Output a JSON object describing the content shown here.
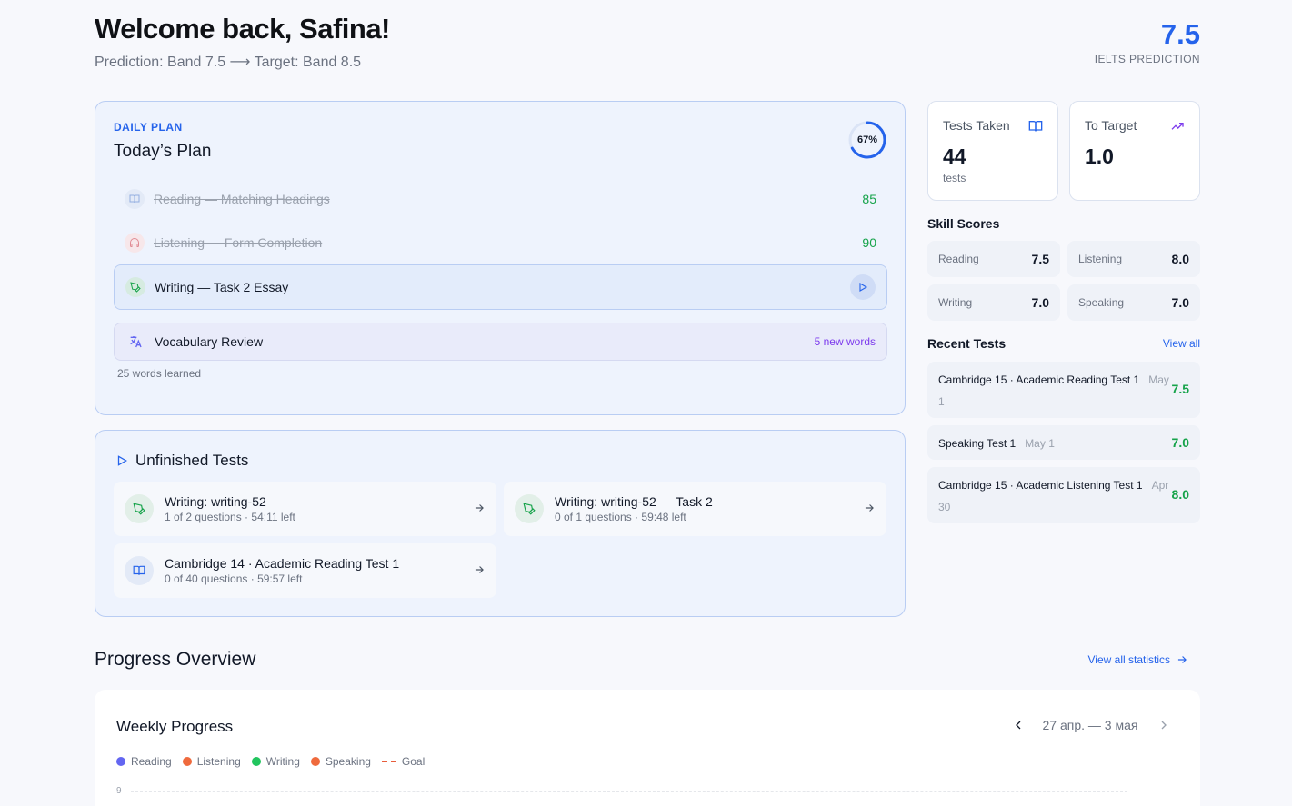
{
  "header": {
    "welcome": "Welcome back, Safina!",
    "prediction_line": "Prediction: Band 7.5 ⟶ Target: Band 8.5",
    "prediction_value": "7.5",
    "prediction_label": "IELTS PREDICTION"
  },
  "daily_plan": {
    "eyebrow": "DAILY PLAN",
    "title": "Today’s Plan",
    "progress_percent": 67,
    "progress_label": "67%",
    "items": [
      {
        "label": "Reading — Matching Headings",
        "score": "85",
        "done": true,
        "icon": "book-icon"
      },
      {
        "label": "Listening — Form Completion",
        "score": "90",
        "done": true,
        "icon": "headphones-icon"
      },
      {
        "label": "Writing — Task 2 Essay",
        "done": false,
        "icon": "pen-icon"
      }
    ],
    "vocab": {
      "label": "Vocabulary Review",
      "badge": "5 new words",
      "icon": "translate-icon"
    },
    "words_learned": "25 words learned"
  },
  "unfinished": {
    "title": "Unfinished Tests",
    "tests": [
      {
        "name": "Writing: writing-52",
        "meta": "1 of 2 questions · 54:11 left",
        "icon": "pen-icon"
      },
      {
        "name": "Writing: writing-52 — Task 2",
        "meta": "0 of 1 questions · 59:48 left",
        "icon": "pen-icon"
      },
      {
        "name": "Cambridge 14 · Academic Reading Test 1",
        "meta": "0 of 40 questions · 59:57 left",
        "icon": "book-icon"
      }
    ]
  },
  "stats": {
    "tests_taken": {
      "label": "Tests Taken",
      "value": "44",
      "unit": "tests"
    },
    "to_target": {
      "label": "To Target",
      "value": "1.0"
    }
  },
  "skills": {
    "title": "Skill Scores",
    "items": [
      {
        "name": "Reading",
        "value": "7.5"
      },
      {
        "name": "Listening",
        "value": "8.0"
      },
      {
        "name": "Writing",
        "value": "7.0"
      },
      {
        "name": "Speaking",
        "value": "7.0"
      }
    ]
  },
  "recent": {
    "title": "Recent Tests",
    "view_all": "View all",
    "items": [
      {
        "name": "Cambridge 15 · Academic Reading Test 1",
        "date": "May 1",
        "score": "7.5"
      },
      {
        "name": "Speaking Test 1",
        "date": "May 1",
        "score": "7.0"
      },
      {
        "name": "Cambridge 15 · Academic Listening Test 1",
        "date": "Apr 30",
        "score": "8.0"
      }
    ]
  },
  "progress": {
    "title": "Progress Overview",
    "view_stats": "View all statistics",
    "weekly": {
      "title": "Weekly Progress",
      "range": "27 апр. — 3 мая",
      "legend": [
        {
          "name": "Reading",
          "color": "#6366f1"
        },
        {
          "name": "Listening",
          "color": "#ef6a3d"
        },
        {
          "name": "Writing",
          "color": "#22c55e"
        },
        {
          "name": "Speaking",
          "color": "#ef6a3d"
        },
        {
          "name": "Goal",
          "color": "#e85d3b"
        }
      ],
      "y_tick_top": "9"
    }
  },
  "colors": {
    "accent": "#2563eb",
    "success": "#16a34a",
    "purple": "#7c3aed"
  }
}
